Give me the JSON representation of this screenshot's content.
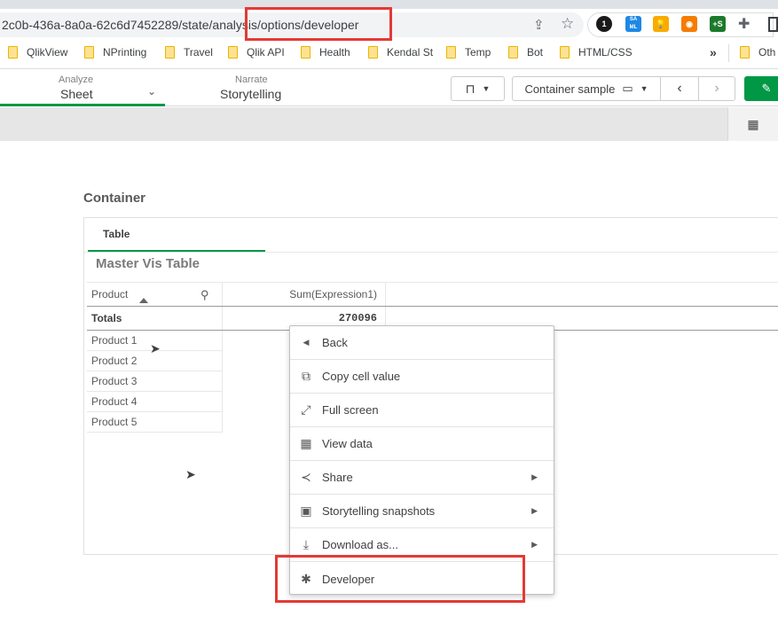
{
  "browser": {
    "url": "2c0b-436a-8a0a-62c6d7452289/state/analysis/options/developer",
    "extensions": [
      {
        "name": "1password",
        "label": "1",
        "color": "#1a1a1a"
      },
      {
        "name": "saml",
        "label": "SA ML",
        "color": "#1e88e5"
      },
      {
        "name": "idea",
        "label": "💡",
        "color": "#f9ab00"
      },
      {
        "name": "rss",
        "label": "◉",
        "color": "#f57c00"
      },
      {
        "name": "plus-s",
        "label": "+S",
        "color": "#1b7a2a"
      }
    ],
    "bookmarks": [
      "QlikView",
      "NPrinting",
      "Travel",
      "Qlik API",
      "Health",
      "Kendal St",
      "Temp",
      "Bot",
      "HTML/CSS"
    ],
    "bookmarks_overflow": "»",
    "other_bookmarks": "Oth"
  },
  "app": {
    "analyze_label": "Analyze",
    "sheet_label": "Sheet",
    "narrate_label": "Narrate",
    "storytelling_label": "Storytelling",
    "sheet_selector": "Container sample",
    "accent": "#009845"
  },
  "container": {
    "title": "Container",
    "tab": "Table",
    "vis_title": "Master Vis Table",
    "columns": [
      "Product",
      "Sum(Expression1)"
    ],
    "totals_label": "Totals",
    "totals_value": "270096",
    "rows": [
      "Product 1",
      "Product 2",
      "Product 3",
      "Product 4",
      "Product 5"
    ]
  },
  "menu": {
    "items": [
      {
        "label": "Back",
        "icon": "back-triangle-icon"
      },
      {
        "label": "Copy cell value",
        "icon": "copy-icon"
      },
      {
        "label": "Full screen",
        "icon": "fullscreen-icon"
      },
      {
        "label": "View data",
        "icon": "table-icon"
      },
      {
        "label": "Share",
        "icon": "share-icon",
        "submenu": true
      },
      {
        "label": "Storytelling snapshots",
        "icon": "snapshot-icon",
        "submenu": true
      },
      {
        "label": "Download as...",
        "icon": "download-icon",
        "submenu": true
      },
      {
        "label": "Developer",
        "icon": "bug-icon"
      }
    ]
  },
  "highlight_color": "#e53935"
}
